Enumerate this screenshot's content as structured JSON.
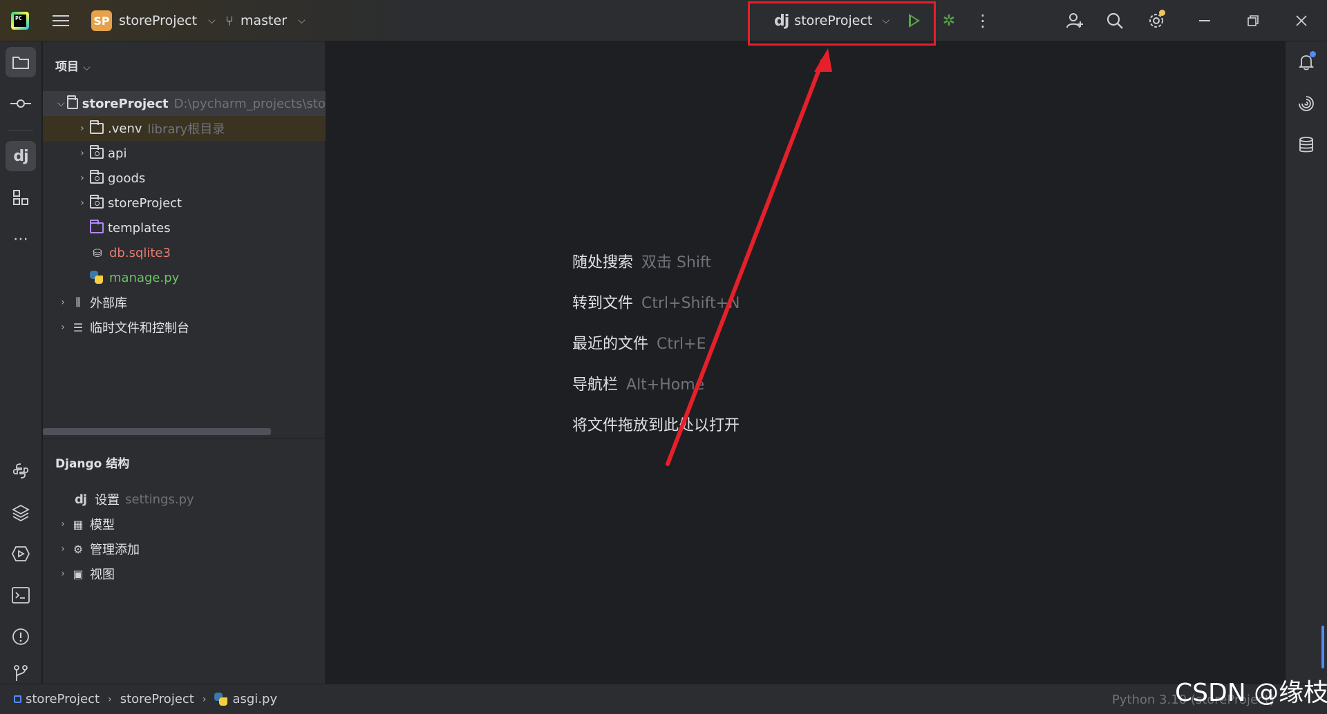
{
  "titlebar": {
    "project_badge": "SP",
    "project_name": "storeProject",
    "branch": "master",
    "run_config_name": "storeProject",
    "run_config_icon": "dj"
  },
  "project_panel": {
    "title": "项目",
    "root": {
      "name": "storeProject",
      "path": "D:\\pycharm_projects\\sto"
    },
    "items": [
      {
        "name": ".venv",
        "hint": "library根目录"
      },
      {
        "name": "api"
      },
      {
        "name": "goods"
      },
      {
        "name": "storeProject"
      },
      {
        "name": "templates"
      },
      {
        "name": "db.sqlite3"
      },
      {
        "name": "manage.py"
      }
    ],
    "external": "外部库",
    "scratches": "临时文件和控制台"
  },
  "django_panel": {
    "title": "Django 结构",
    "settings_label": "设置",
    "settings_file": "settings.py",
    "models": "模型",
    "admin": "管理添加",
    "views": "视图"
  },
  "editor_hints": [
    {
      "action": "随处搜索",
      "shortcut": "双击 Shift"
    },
    {
      "action": "转到文件",
      "shortcut": "Ctrl+Shift+N"
    },
    {
      "action": "最近的文件",
      "shortcut": "Ctrl+E"
    },
    {
      "action": "导航栏",
      "shortcut": "Alt+Home"
    },
    {
      "action": "将文件拖放到此处以打开",
      "shortcut": ""
    }
  ],
  "statusbar": {
    "breadcrumb": [
      "storeProject",
      "storeProject",
      "asgi.py"
    ],
    "interpreter": "Python 3.10 (storeProject)"
  },
  "watermark": "CSDN @缘枝",
  "colors": {
    "accent_run": "#57a64a",
    "highlight": "#e5202a",
    "badge": "#e5a24b",
    "background": "#1e1f22",
    "panel": "#2b2d30"
  },
  "icons": {
    "left_strip": [
      "folder-icon",
      "commit-icon",
      "django-icon",
      "structure-icon",
      "more-icon",
      "python-console-icon",
      "layers-icon",
      "services-icon",
      "terminal-icon",
      "problems-icon",
      "git-icon"
    ],
    "right_strip": [
      "notifications-icon",
      "ai-assistant-icon",
      "database-icon"
    ]
  }
}
